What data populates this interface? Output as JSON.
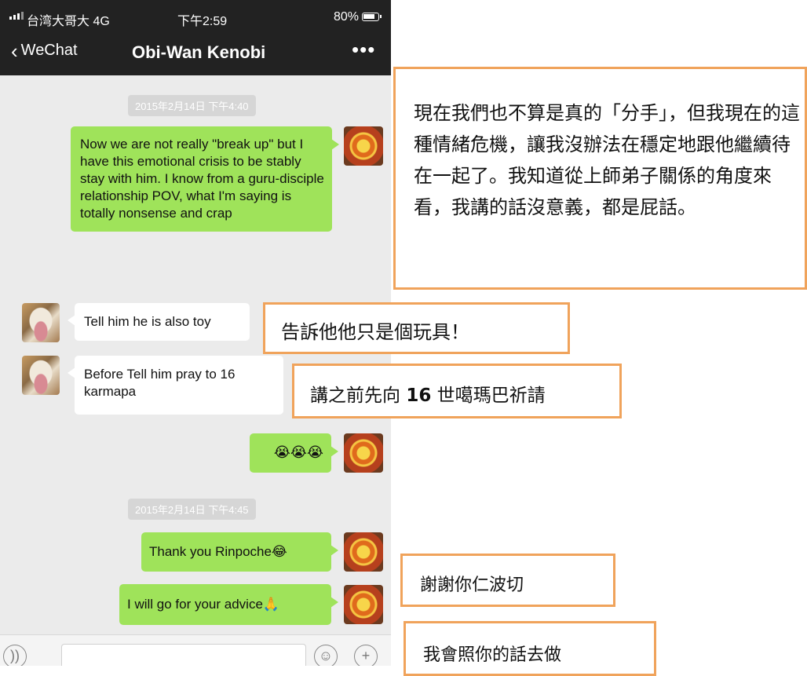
{
  "status_bar": {
    "carrier": "台湾大哥大 4G",
    "time": "下午2:59",
    "battery": "80%"
  },
  "nav": {
    "back_label": "WeChat",
    "title": "Obi-Wan Kenobi",
    "more": "•••"
  },
  "messages": {
    "ts1": "2015年2月14日 下午4:40",
    "m1": "Now we are not really \"break up\" but I have this emotional crisis to be stably stay with him. I know from a guru-disciple relationship POV, what I'm saying is totally nonsense and crap",
    "m2": "Tell him he is also toy",
    "m3": "Before Tell him pray to 16 karmapa",
    "m4": "😭😭😭",
    "ts2": "2015年2月14日 下午4:45",
    "m5": "Thank you Rinpoche😂",
    "m6": "I will go for your advice🙏"
  },
  "input_bar": {
    "voice_icon": "voice-icon",
    "emoji_icon": "emoji-icon",
    "plus_icon": "plus-icon"
  },
  "annotations": {
    "n1": "現在我們也不算是真的「分手」，但我現在的這種情緒危機，讓我沒辦法在穩定地跟他繼續待在一起了。我知道從上師弟子關係的角度來看，我講的話沒意義，都是屁話。",
    "n2": "告訴他他只是個玩具！",
    "n3_pre": "講之前先向 ",
    "n3_num": "16",
    "n3_post": " 世噶瑪巴祈請",
    "n4": "謝謝你仁波切",
    "n5": "我會照你的話去做"
  },
  "colors": {
    "bubble_out": "#9fe35a",
    "bubble_in": "#ffffff",
    "header_bg": "#222222",
    "chat_bg": "#ebebeb",
    "note_border": "#f0a35b"
  }
}
